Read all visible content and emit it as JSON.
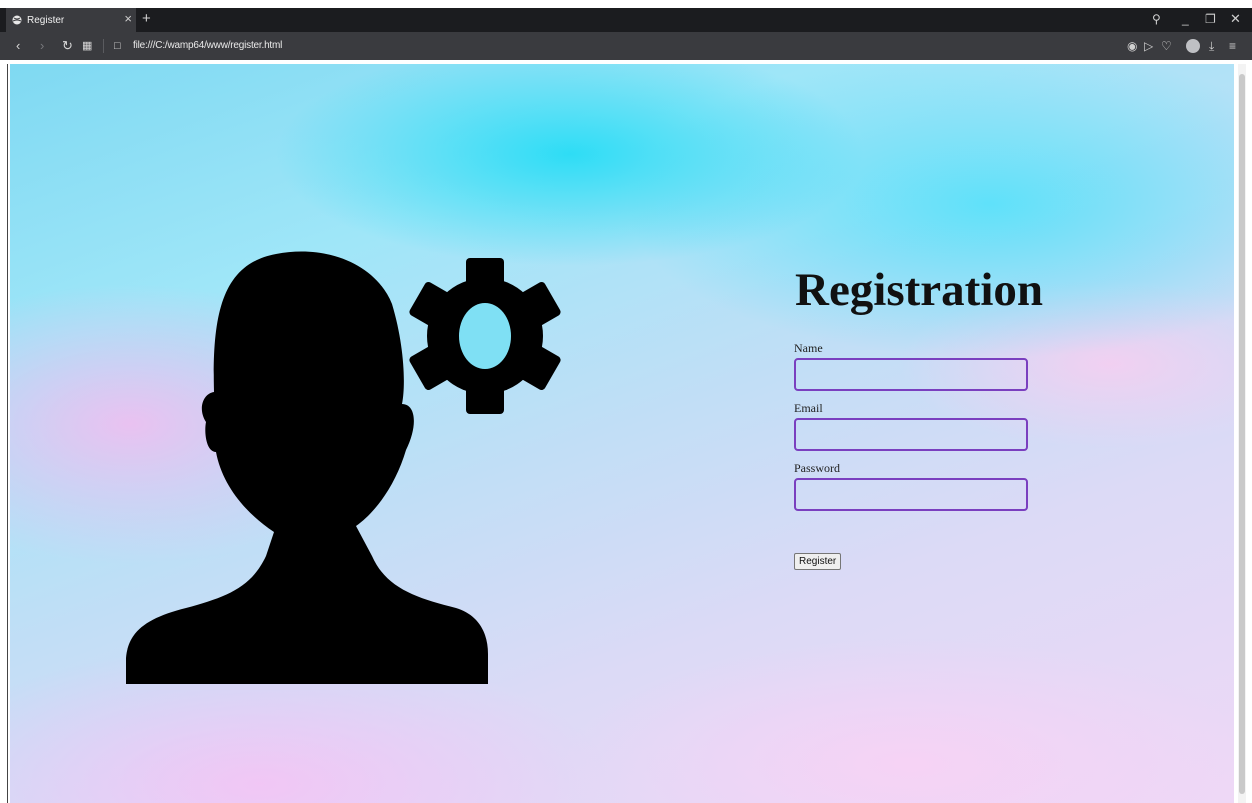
{
  "browser": {
    "tab_title": "Register",
    "tab_close": "×",
    "new_tab": "+",
    "url": "file:///C:/wamp64/www/register.html",
    "icons": [
      "globe-icon",
      "back-icon",
      "forward-icon",
      "reload-icon",
      "tab-grid-icon",
      "page-icon",
      "search-icon",
      "minimize-icon",
      "restore-icon",
      "close-icon",
      "camera-icon",
      "play-icon",
      "heart-icon",
      "avatar-icon",
      "download-icon",
      "menu-icon"
    ]
  },
  "page": {
    "title": "Registration",
    "fields": [
      {
        "label": "Name",
        "value": ""
      },
      {
        "label": "Email",
        "value": ""
      },
      {
        "label": "Password",
        "value": ""
      }
    ],
    "submit_label": "Register",
    "accent_color": "#7a3fbf",
    "illustration": [
      "person-silhouette-icon",
      "gear-icon"
    ]
  }
}
